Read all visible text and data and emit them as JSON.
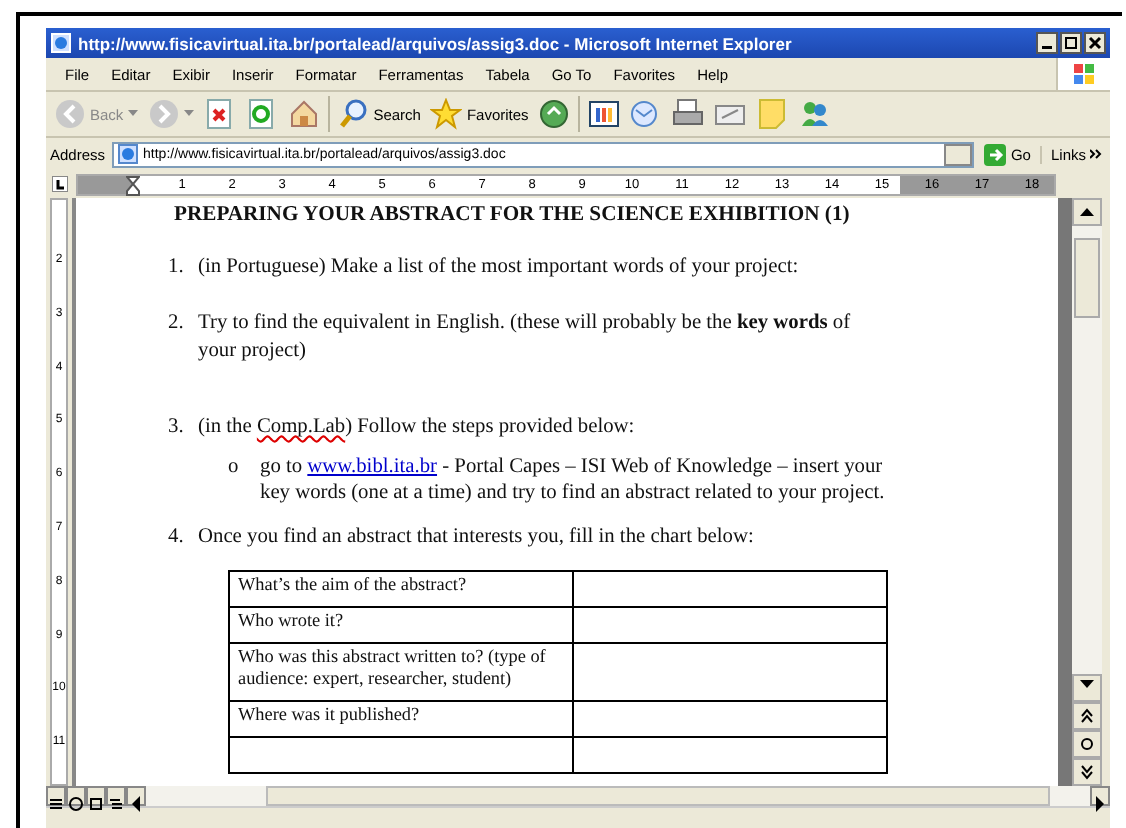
{
  "window": {
    "title": "http://www.fisicavirtual.ita.br/portalead/arquivos/assig3.doc - Microsoft Internet Explorer"
  },
  "menu": [
    "File",
    "Editar",
    "Exibir",
    "Inserir",
    "Formatar",
    "Ferramentas",
    "Tabela",
    "Go To",
    "Favorites",
    "Help"
  ],
  "toolbar": {
    "back": "Back",
    "search": "Search",
    "favorites": "Favorites"
  },
  "address": {
    "label": "Address",
    "url": "http://www.fisicavirtual.ita.br/portalead/arquivos/assig3.doc",
    "go": "Go",
    "links": "Links"
  },
  "ruler": {
    "marks": [
      "1",
      "2",
      "3",
      "4",
      "5",
      "6",
      "7",
      "8",
      "9",
      "10",
      "11",
      "12",
      "13",
      "14",
      "15",
      "16",
      "17",
      "18"
    ],
    "vertical_marks": [
      "2",
      "3",
      "4",
      "5",
      "6",
      "7",
      "8",
      "9",
      "10",
      "11"
    ]
  },
  "document": {
    "heading": "PREPARING YOUR ABSTRACT FOR THE SCIENCE EXHIBITION (1)",
    "items": [
      {
        "number": "1.",
        "parts": [
          {
            "text": "(in Portuguese) Make a list of the most important words of your project:"
          }
        ]
      },
      {
        "number": "2.",
        "parts": [
          {
            "text": "Try to find the equivalent in English. (these will probably be the "
          },
          {
            "text": "key words",
            "kind": "bold"
          },
          {
            "text": " of your project)"
          }
        ]
      },
      {
        "number": "3.",
        "parts": [
          {
            "text": "(in the "
          },
          {
            "text": "Comp.Lab",
            "kind": "misspelled"
          },
          {
            "text": ") Follow the steps provided below:"
          }
        ],
        "bullets": [
          {
            "marker": "o",
            "parts": [
              {
                "text": "go to "
              },
              {
                "text": "www.bibl.ita.br",
                "kind": "link"
              },
              {
                "text": " - Portal Capes – ISI Web of Knowledge – insert your key words (one at a time) and try to find an abstract related to your project."
              }
            ]
          }
        ]
      },
      {
        "number": "4.",
        "parts": [
          {
            "text": "Once you find an abstract that interests you, fill in the chart below:"
          }
        ]
      }
    ],
    "table": {
      "rows": [
        "What’s the aim of the abstract?",
        "Who wrote it?",
        "Who was this abstract written to? (type of audience: expert, researcher, student)",
        "Where was it published?"
      ]
    }
  }
}
